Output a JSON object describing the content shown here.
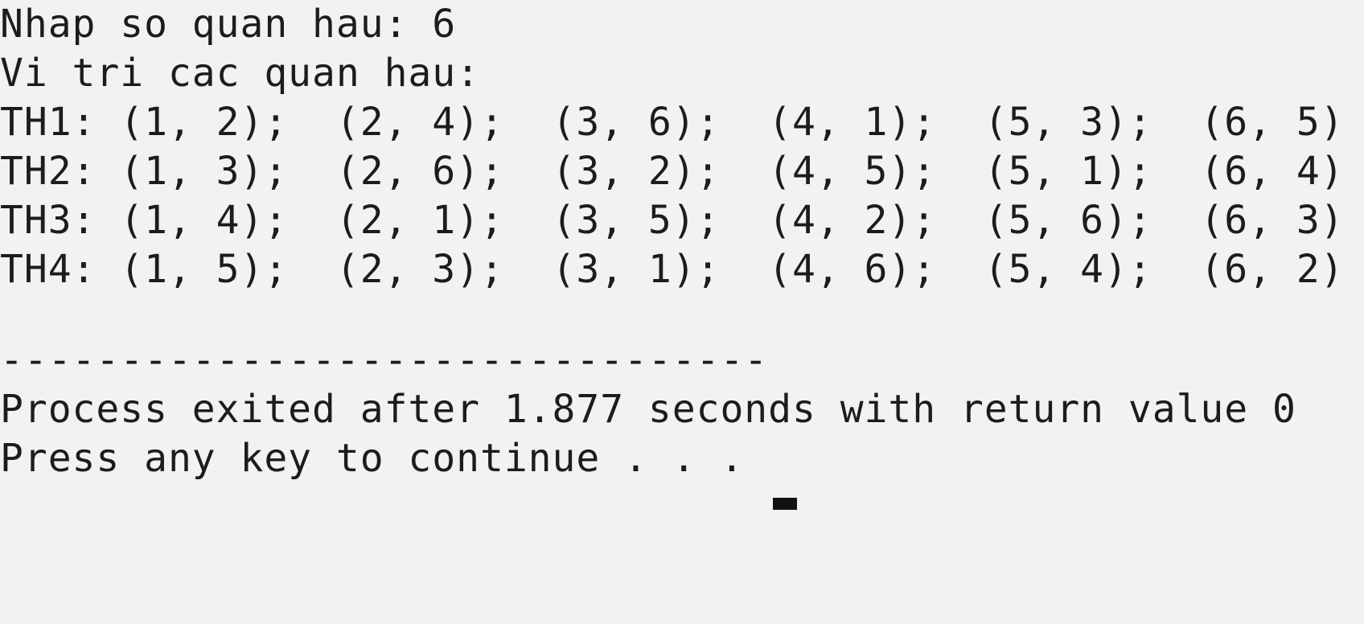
{
  "console": {
    "prompt_line": "Nhap so quan hau: 6",
    "heading_line": "Vi tri cac quan hau:",
    "solutions": [
      "TH1: (1, 2);  (2, 4);  (3, 6);  (4, 1);  (5, 3);  (6, 5)",
      "TH2: (1, 3);  (2, 6);  (3, 2);  (4, 5);  (5, 1);  (6, 4)",
      "TH3: (1, 4);  (2, 1);  (3, 5);  (4, 2);  (5, 6);  (6, 3)",
      "TH4: (1, 5);  (2, 3);  (3, 1);  (4, 6);  (5, 4);  (6, 2)"
    ],
    "separator": "--------------------------------",
    "exit_line": "Process exited after 1.877 seconds with return value 0",
    "continue_line": "Press any key to continue . . . "
  },
  "colors": {
    "background": "#f2f2f2",
    "text": "#1c1c1c",
    "cursor": "#111111"
  }
}
